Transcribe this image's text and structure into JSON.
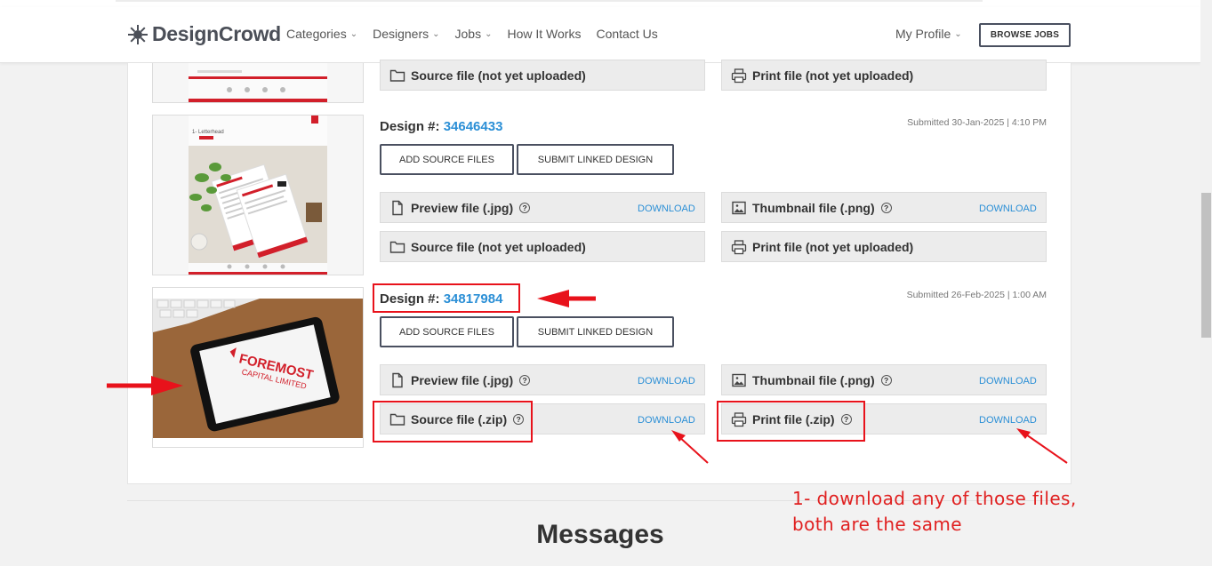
{
  "header": {
    "logo_text": "DesignCrowd",
    "nav": [
      "Categories",
      "Designers",
      "Jobs",
      "How It Works",
      "Contact Us"
    ],
    "nav_has_chevron": [
      true,
      true,
      true,
      false,
      false
    ],
    "profile_label": "My Profile",
    "browse_jobs_label": "BROWSE JOBS"
  },
  "designs": [
    {
      "files": {
        "source_label": "Source file (not yet uploaded)",
        "print_label": "Print file (not yet uploaded)"
      }
    },
    {
      "title_prefix": "Design #:",
      "number": "34646433",
      "submitted": "Submitted 30-Jan-2025 | 4:10 PM",
      "add_source_label": "ADD SOURCE FILES",
      "submit_linked_label": "SUBMIT LINKED DESIGN",
      "thumb_text": "1- Letterhead",
      "files": {
        "preview_label": "Preview file (.jpg)",
        "thumbnail_label": "Thumbnail file (.png)",
        "source_label": "Source file (not yet uploaded)",
        "print_label": "Print file (not yet uploaded)",
        "download_label": "DOWNLOAD"
      }
    },
    {
      "title_prefix": "Design #:",
      "number": "34817984",
      "submitted": "Submitted 26-Feb-2025 | 1:00 AM",
      "add_source_label": "ADD SOURCE FILES",
      "submit_linked_label": "SUBMIT LINKED DESIGN",
      "thumb_text": "FOREMOST CAPITAL LIMITED",
      "files": {
        "preview_label": "Preview file (.jpg)",
        "thumbnail_label": "Thumbnail file (.png)",
        "source_label": "Source file (.zip)",
        "print_label": "Print file (.zip)",
        "download_label": "DOWNLOAD"
      }
    }
  ],
  "annotation": {
    "line1": "1- download any of those files,",
    "line2": "both are the same",
    "color": "#e8121b"
  },
  "messages_heading": "Messages",
  "colors": {
    "link": "#2b8fd6",
    "button_border": "#4a5060",
    "annotation_red": "#e8121b"
  }
}
